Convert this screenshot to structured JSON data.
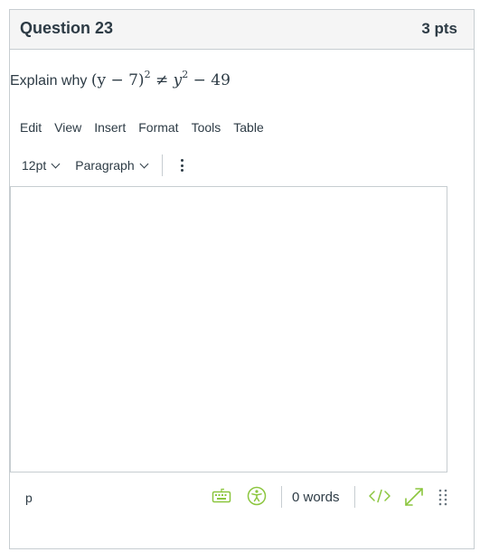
{
  "question": {
    "title": "Question 23",
    "points": "3 pts",
    "prompt_prefix": "Explain why",
    "math": {
      "lhs_base": "(y − 7)",
      "lhs_exp": "2",
      "relation": "≠",
      "rhs_var": "y",
      "rhs_exp": "2",
      "rhs_tail": "− 49"
    }
  },
  "editor": {
    "menubar": [
      "Edit",
      "View",
      "Insert",
      "Format",
      "Tools",
      "Table"
    ],
    "font_size": "12pt",
    "block_format": "Paragraph",
    "content": "",
    "status": {
      "path": "p",
      "word_count": "0 words"
    }
  },
  "icons": {
    "more": "more-vertical-icon",
    "keyboard": "keyboard-icon",
    "accessibility": "accessibility-icon",
    "html_editor": "code-icon",
    "fullscreen": "expand-icon",
    "resize": "resize-handle-icon"
  },
  "colors": {
    "accent": "#8cc63f",
    "text": "#2d3b45",
    "border": "#c7cdd1",
    "header_bg": "#f5f5f5"
  }
}
